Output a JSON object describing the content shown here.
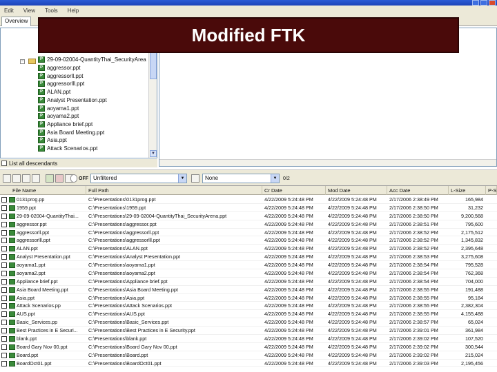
{
  "menu": [
    "Edit",
    "View",
    "Tools",
    "Help"
  ],
  "tabs": [
    "Overview"
  ],
  "overlay_title": "Modified FTK",
  "tree_items": [
    "29-09-02004-QuantityThai_SecurityArea",
    "aggressor.ppt",
    "aggressorll.ppt",
    "aggressorlll.ppt",
    "ALAN.ppt",
    "Analyst Presentation.ppt",
    "aoyama1.ppt",
    "aoyama2.ppt",
    "Appliance brief.ppt",
    "Asia Board Meeting.ppt",
    "Asia.ppt",
    "Attack Scenarios.ppt"
  ],
  "descendants_label": "List all descendants",
  "toolbar": {
    "off_label": "OFF",
    "filter_value": "Unfiltered",
    "view_value": "None",
    "view_suffix": "0/2"
  },
  "columns": [
    "File Name",
    "Full Path",
    "Cr Date",
    "Mod Date",
    "Acc Date",
    "L-Size",
    "P-Size"
  ],
  "rows": [
    {
      "name": "0131prog.pp",
      "path": "C:\\Presentations\\0131prog.ppt",
      "cr": "4/22/2009 5:24:48 PM",
      "mod": "4/22/2009 5:24:48 PM",
      "acc": "2/17/2006 2:38:49 PM",
      "size": "165,984"
    },
    {
      "name": "1959.ppt",
      "path": "C:\\Presentations\\1959.ppt",
      "cr": "4/22/2009 5:24:48 PM",
      "mod": "4/22/2009 5:24:48 PM",
      "acc": "2/17/2006 2:38:50 PM",
      "size": "31,232"
    },
    {
      "name": "29-09-02004-QuantityThai...",
      "path": "C:\\Presentations\\29-09-02004-QuantityThai_SecurityArena.ppt",
      "cr": "4/22/2009 5:24:48 PM",
      "mod": "4/22/2009 5:24:48 PM",
      "acc": "2/17/2006 2:38:50 PM",
      "size": "9,200,568"
    },
    {
      "name": "aggressor.ppt",
      "path": "C:\\Presentations\\aggressor.ppt",
      "cr": "4/22/2009 5:24:48 PM",
      "mod": "4/22/2009 5:24:48 PM",
      "acc": "2/17/2006 2:38:51 PM",
      "size": "795,600"
    },
    {
      "name": "aggressorll.ppt",
      "path": "C:\\Presentations\\aggressorll.ppt",
      "cr": "4/22/2009 5:24:48 PM",
      "mod": "4/22/2009 5:24:48 PM",
      "acc": "2/17/2006 2:38:52 PM",
      "size": "2,175,512"
    },
    {
      "name": "aggressorlll.ppt",
      "path": "C:\\Presentations\\aggressorlll.ppt",
      "cr": "4/22/2009 5:24:48 PM",
      "mod": "4/22/2009 5:24:48 PM",
      "acc": "2/17/2006 2:38:52 PM",
      "size": "1,345,832"
    },
    {
      "name": "ALAN.ppt",
      "path": "C:\\Presentations\\ALAN.ppt",
      "cr": "4/22/2009 5:24:48 PM",
      "mod": "4/22/2009 5:24:48 PM",
      "acc": "2/17/2006 2:38:52 PM",
      "size": "2,395,648"
    },
    {
      "name": "Analyst Presentation.ppt",
      "path": "C:\\Presentations\\Analyst Presentation.ppt",
      "cr": "4/22/2009 5:24:48 PM",
      "mod": "4/22/2009 5:24:48 PM",
      "acc": "2/17/2006 2:38:53 PM",
      "size": "3,275,608"
    },
    {
      "name": "aoyama1.ppt",
      "path": "C:\\Presentations\\aoyama1.ppt",
      "cr": "4/22/2009 5:24:48 PM",
      "mod": "4/22/2009 5:24:48 PM",
      "acc": "2/17/2006 2:38:54 PM",
      "size": "795,528"
    },
    {
      "name": "aoyama2.ppt",
      "path": "C:\\Presentations\\aoyama2.ppt",
      "cr": "4/22/2009 5:24:48 PM",
      "mod": "4/22/2009 5:24:48 PM",
      "acc": "2/17/2006 2:38:54 PM",
      "size": "762,368"
    },
    {
      "name": "Appliance brief.ppt",
      "path": "C:\\Presentations\\Appliance brief.ppt",
      "cr": "4/22/2009 5:24:48 PM",
      "mod": "4/22/2009 5:24:48 PM",
      "acc": "2/17/2006 2:38:54 PM",
      "size": "704,000"
    },
    {
      "name": "Asia Board Meeting.ppt",
      "path": "C:\\Presentations\\Asia Board Meeting.ppt",
      "cr": "4/22/2009 5:24:48 PM",
      "mod": "4/22/2009 5:24:48 PM",
      "acc": "2/17/2006 2:38:55 PM",
      "size": "191,488"
    },
    {
      "name": "Asia.ppt",
      "path": "C:\\Presentations\\Asia.ppt",
      "cr": "4/22/2009 5:24:48 PM",
      "mod": "4/22/2009 5:24:48 PM",
      "acc": "2/17/2006 2:38:55 PM",
      "size": "95,184"
    },
    {
      "name": "Attack Scenarios.pp",
      "path": "C:\\Presentations\\Attack Scenarios.ppt",
      "cr": "4/22/2009 5:24:48 PM",
      "mod": "4/22/2009 5:24:48 PM",
      "acc": "2/17/2006 2:38:55 PM",
      "size": "2,382,304"
    },
    {
      "name": "AUS.ppt",
      "path": "C:\\Presentations\\AUS.ppt",
      "cr": "4/22/2009 5:24:48 PM",
      "mod": "4/22/2009 5:24:48 PM",
      "acc": "2/17/2006 2:38:55 PM",
      "size": "4,155,488"
    },
    {
      "name": "Basic_Services.pp",
      "path": "C:\\Presentations\\Basic_Services.ppt",
      "cr": "4/22/2009 5:24:48 PM",
      "mod": "4/22/2009 5:24:48 PM",
      "acc": "2/17/2006 2:38:57 PM",
      "size": "65,024"
    },
    {
      "name": "Best Practices in E Securi...",
      "path": "C:\\Presentations\\Best Practices in E Security.ppt",
      "cr": "4/22/2009 5:24:48 PM",
      "mod": "4/22/2009 5:24:48 PM",
      "acc": "2/17/2006 2:39:01 PM",
      "size": "361,984"
    },
    {
      "name": "blank.ppt",
      "path": "C:\\Presentations\\blank.ppt",
      "cr": "4/22/2009 5:24:48 PM",
      "mod": "4/22/2009 5:24:48 PM",
      "acc": "2/17/2006 2:39:02 PM",
      "size": "107,520"
    },
    {
      "name": "Board Gary Nov 00.ppt",
      "path": "C:\\Presentations\\Board Gary Nov 00.ppt",
      "cr": "4/22/2009 5:24:48 PM",
      "mod": "4/22/2009 5:24:48 PM",
      "acc": "2/17/2006 2:39:02 PM",
      "size": "300,544"
    },
    {
      "name": "Board.ppt",
      "path": "C:\\Presentations\\Board.ppt",
      "cr": "4/22/2009 5:24:48 PM",
      "mod": "4/22/2009 5:24:48 PM",
      "acc": "2/17/2006 2:39:02 PM",
      "size": "215,024"
    },
    {
      "name": "BoardOct01.ppt",
      "path": "C:\\Presentations\\BoardOct01.ppt",
      "cr": "4/22/2009 5:24:48 PM",
      "mod": "4/22/2009 5:24:48 PM",
      "acc": "2/17/2006 2:39:03 PM",
      "size": "2,195,456"
    }
  ]
}
